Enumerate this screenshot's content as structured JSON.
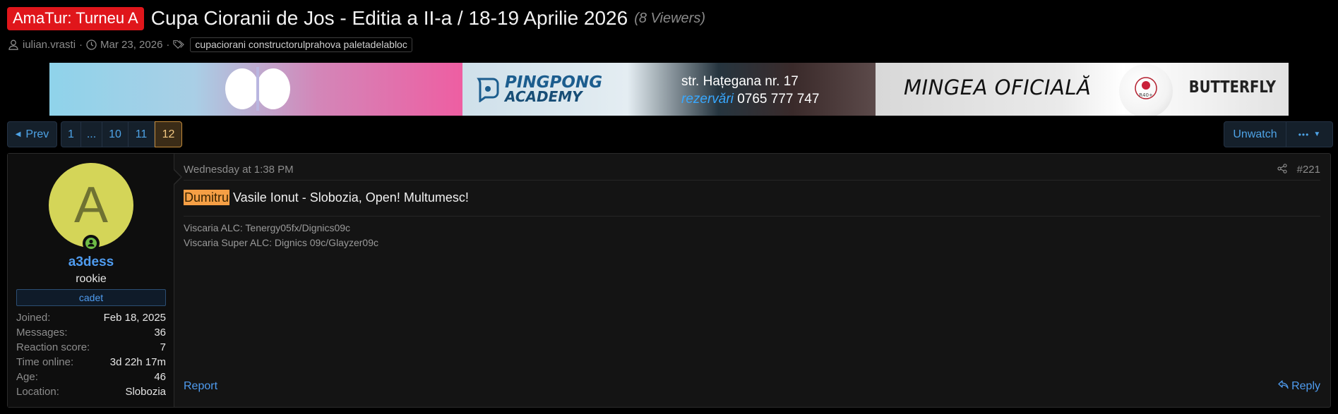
{
  "thread": {
    "prefix": "AmaTur: Turneu A",
    "title": "Cupa Cioranii de Jos - Editia a II-a / 18-19 Aprilie 2026",
    "viewers": "(8 Viewers)",
    "author": "iulian.vrasti",
    "date": "Mar 23, 2026",
    "tags": "cupaciorani constructorulprahova paletadelabloc"
  },
  "banner": {
    "ad2_line1": "PINGPONG",
    "ad2_line2": "ACADEMY",
    "ad2_addr": "str. Hațegana nr. 17",
    "ad2_rez_label": "rezervări",
    "ad2_phone": "0765 777 747",
    "ad3_text": "MINGEA OFICIALĂ",
    "ad3_brand": "BUTTERFLY"
  },
  "pagination": {
    "prev": "Prev",
    "pages": [
      "1",
      "...",
      "10",
      "11",
      "12"
    ],
    "current": "12",
    "unwatch": "Unwatch",
    "more": "•••"
  },
  "post": {
    "user": {
      "avatar_letter": "A",
      "name": "a3dess",
      "title": "rookie",
      "banner": "cadet",
      "stats": [
        {
          "k": "Joined:",
          "v": "Feb 18, 2025"
        },
        {
          "k": "Messages:",
          "v": "36"
        },
        {
          "k": "Reaction score:",
          "v": "7"
        },
        {
          "k": "Time online:",
          "v": "3d 22h 17m"
        },
        {
          "k": "Age:",
          "v": "46"
        },
        {
          "k": "Location:",
          "v": "Slobozia"
        }
      ]
    },
    "time": "Wednesday at 1:38 PM",
    "number": "#221",
    "message_highlight": "Dumitru",
    "message_rest": " Vasile Ionut - Slobozia, Open! Multumesc!",
    "signature": [
      "Viscaria ALC: Tenergy05fx/Dignics09c",
      "Viscaria Super ALC: Dignics 09c/Glayzer09c"
    ],
    "report": "Report",
    "reply": "Reply"
  },
  "colors": {
    "prefix_red": "#e0161b",
    "link_blue": "#4f9cf0",
    "active_page": "#c28a3a",
    "highlight": "#f59f45",
    "avatar": "#d4d558",
    "online": "#6dbb45"
  }
}
